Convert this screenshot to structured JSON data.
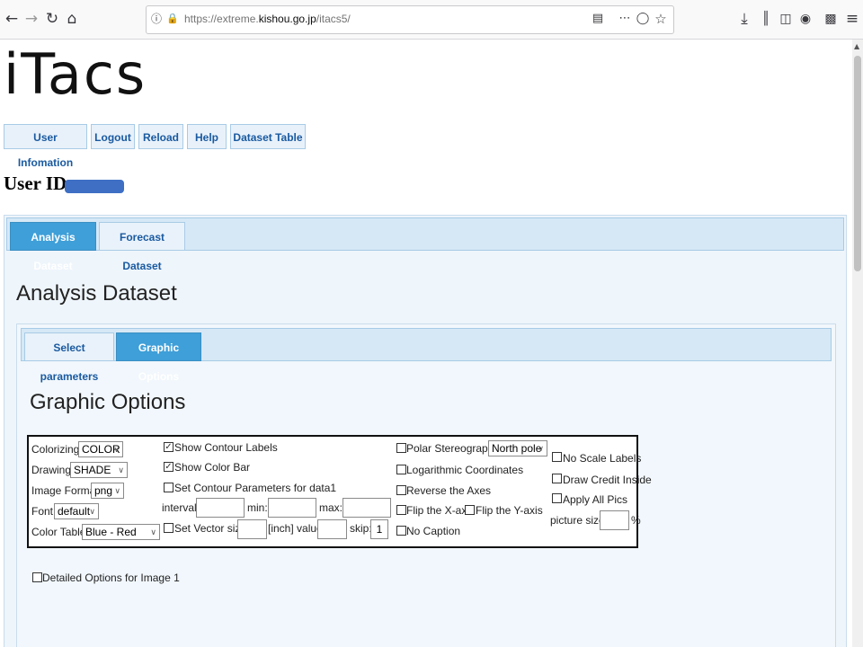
{
  "browser": {
    "url_prefix": "https://extreme.",
    "url_domain": "kishou.go.jp",
    "url_path": "/itacs5/",
    "icons": {
      "back": "back-arrow-icon",
      "forward": "forward-arrow-icon",
      "reload": "reload-icon",
      "home": "home-icon",
      "info": "site-info-icon",
      "lock": "lock-icon",
      "reader": "reader-view-icon",
      "more": "page-actions-icon",
      "pocket": "pocket-icon",
      "bookmark": "bookmark-star-icon",
      "download": "download-icon",
      "library": "library-icon",
      "sidebar": "sidebar-icon",
      "account": "account-icon",
      "extensions": "extensions-icon",
      "menu": "hamburger-menu-icon"
    }
  },
  "app": {
    "logo": "iTacs"
  },
  "menu": [
    "User Infomation",
    "Logout",
    "Reload",
    "Help",
    "Dataset Table"
  ],
  "user": {
    "label": "User ID:"
  },
  "dataset_tabs": [
    {
      "label": "Analysis Dataset",
      "active": true
    },
    {
      "label": "Forecast Dataset",
      "active": false
    }
  ],
  "section_heading": "Analysis Dataset",
  "sub_tabs": [
    {
      "label": "Select parameters",
      "active": false
    },
    {
      "label": "Graphic Options",
      "active": true
    }
  ],
  "graphic_heading": "Graphic Options",
  "options": {
    "colorizing": {
      "label": "Colorizing:",
      "value": "COLOR"
    },
    "drawing": {
      "label": "Drawing:",
      "value": "SHADE"
    },
    "image_format": {
      "label": "Image Format:",
      "value": "png"
    },
    "font": {
      "label": "Font:",
      "value": "default"
    },
    "color_table": {
      "label": "Color Table:",
      "value": "Blue - Red"
    },
    "show_contour_labels": {
      "label": "Show Contour Labels",
      "checked": true
    },
    "show_color_bar": {
      "label": "Show Color Bar",
      "checked": true
    },
    "set_contour_params": {
      "label": "Set Contour Parameters for data1",
      "checked": false
    },
    "interval_label": "interval:",
    "min_label": "min:",
    "max_label": "max:",
    "set_vector_size": {
      "label": "Set Vector size:",
      "checked": false
    },
    "inch_value_label": "[inch] value:",
    "skip_label": "skip:",
    "skip_value": "1",
    "polar_stereographic": {
      "label": "Polar Stereographic:",
      "checked": false
    },
    "pole": {
      "value": "North pole"
    },
    "logarithmic": {
      "label": "Logarithmic Coordinates",
      "checked": false
    },
    "reverse_axes": {
      "label": "Reverse the Axes",
      "checked": false
    },
    "flip_x": {
      "label": "Flip the X-axis",
      "checked": false
    },
    "flip_y": {
      "label": "Flip the Y-axis",
      "checked": false
    },
    "no_caption": {
      "label": "No Caption",
      "checked": false
    },
    "no_scale_labels": {
      "label": "No Scale Labels",
      "checked": false
    },
    "draw_credit": {
      "label": "Draw Credit Inside",
      "checked": false
    },
    "apply_all": {
      "label": "Apply All Pics",
      "checked": false
    },
    "picture_size_label": "picture size",
    "percent_label": "%"
  },
  "detailed_options": {
    "label": "Detailed Options for Image 1",
    "checked": false
  }
}
